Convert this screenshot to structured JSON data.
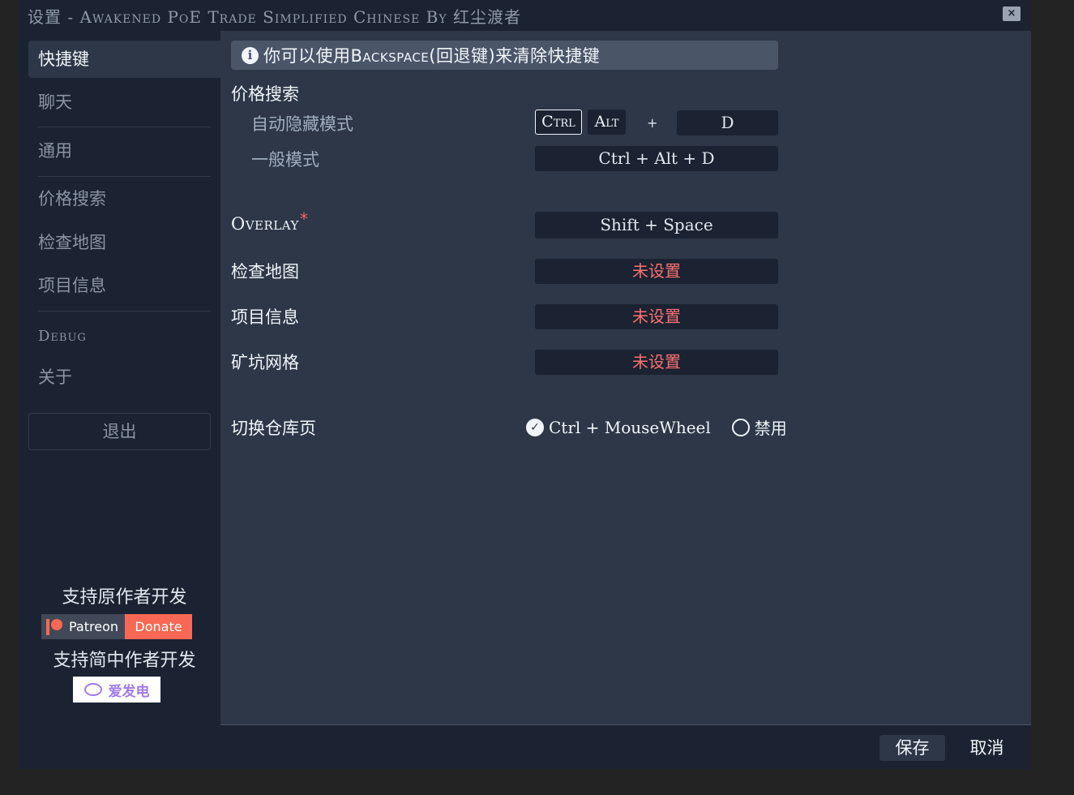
{
  "window": {
    "title": "设置 - Awakened PoE Trade Simplified Chinese By 红尘渡者",
    "close_label": "×"
  },
  "sidebar": {
    "items": [
      {
        "label": "快捷键",
        "active": true
      },
      {
        "label": "聊天"
      },
      {
        "label": "通用"
      },
      {
        "label": "价格搜索"
      },
      {
        "label": "检查地图"
      },
      {
        "label": "项目信息"
      },
      {
        "label": "Debug"
      },
      {
        "label": "关于"
      }
    ],
    "exit_label": "退出",
    "support_original": "支持原作者开发",
    "patreon_label": "Patreon",
    "donate_label": "Donate",
    "support_cn": "支持简中作者开发",
    "afdian_label": "爱发电"
  },
  "main": {
    "info_banner": "你可以使用Backspace(回退键)来清除快捷键",
    "price_section": {
      "title": "价格搜索",
      "auto_hide_label": "自动隐藏模式",
      "ctrl_label": "Ctrl",
      "alt_label": "Alt",
      "plus": "+",
      "auto_hide_key": "D",
      "normal_label": "一般模式",
      "normal_key": "Ctrl + Alt + D"
    },
    "overlay": {
      "label": "Overlay",
      "required_mark": "*",
      "key": "Shift + Space"
    },
    "check_map": {
      "label": "检查地图",
      "key": "未设置"
    },
    "item_info": {
      "label": "项目信息",
      "key": "未设置"
    },
    "delve_grid": {
      "label": "矿坑网格",
      "key": "未设置"
    },
    "stash_switch": {
      "label": "切换仓库页",
      "option_on": "Ctrl + MouseWheel",
      "option_off": "禁用",
      "selected": "Ctrl + MouseWheel"
    }
  },
  "footer": {
    "save_label": "保存",
    "cancel_label": "取消"
  }
}
